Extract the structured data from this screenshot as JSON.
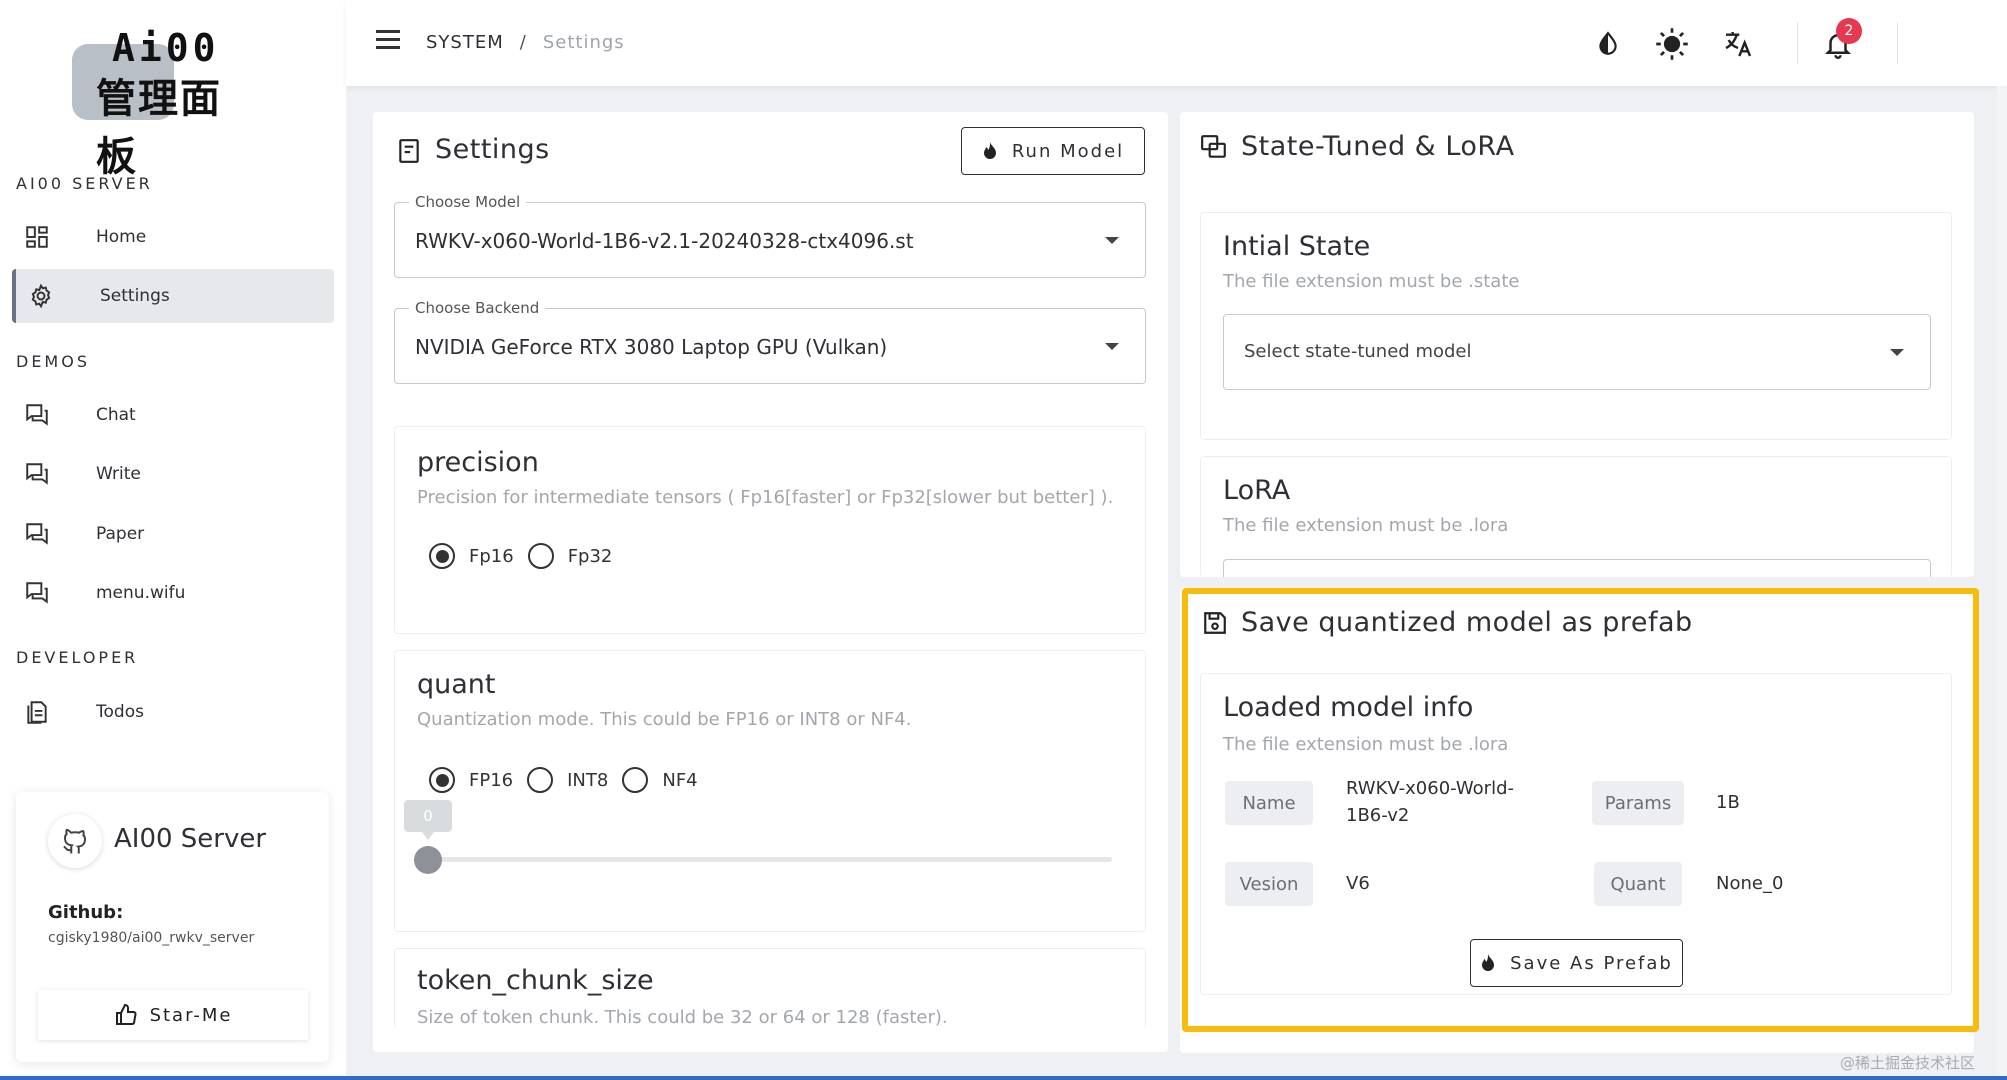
{
  "logo": {
    "line1": "Ai00",
    "line2": "管理面板"
  },
  "sidebar": {
    "sections": [
      {
        "title": "AI00 SERVER"
      },
      {
        "title": "DEMOS"
      },
      {
        "title": "DEVELOPER"
      }
    ],
    "items": [
      {
        "label": "Home",
        "icon": "dashboard-icon"
      },
      {
        "label": "Settings",
        "icon": "gear-icon",
        "active": true
      },
      {
        "label": "Chat",
        "icon": "forum-icon"
      },
      {
        "label": "Write",
        "icon": "forum-icon"
      },
      {
        "label": "Paper",
        "icon": "forum-icon"
      },
      {
        "label": "menu.wifu",
        "icon": "forum-icon"
      },
      {
        "label": "Todos",
        "icon": "document-icon"
      }
    ],
    "github_card": {
      "title": "AI00 Server",
      "github_label": "Github:",
      "url": "cgisky1980/ai00_rwkv_server",
      "star_label": "Star-Me"
    }
  },
  "header": {
    "breadcrumb": [
      "SYSTEM",
      "/",
      "Settings"
    ],
    "notification_count": "2",
    "icons": [
      "contrast-icon",
      "brightness-icon",
      "translate-icon",
      "bell-icon"
    ]
  },
  "settings": {
    "title": "Settings",
    "run_label": "Run Model",
    "model": {
      "legend": "Choose Model",
      "value": "RWKV-x060-World-1B6-v2.1-20240328-ctx4096.st"
    },
    "backend": {
      "legend": "Choose Backend",
      "value": "NVIDIA GeForce RTX 3080 Laptop GPU (Vulkan)"
    },
    "precision": {
      "title": "precision",
      "subtitle": "Precision for intermediate tensors ( Fp16[faster] or Fp32[slower but better] ).",
      "options": [
        "Fp16",
        "Fp32"
      ],
      "selected": "Fp16"
    },
    "quant": {
      "title": "quant",
      "subtitle": "Quantization mode. This could be FP16 or INT8 or NF4.",
      "options": [
        "FP16",
        "INT8",
        "NF4"
      ],
      "selected": "FP16",
      "slider_value": "0"
    },
    "token_chunk": {
      "title": "token_chunk_size",
      "subtitle": "Size of token chunk. This could be 32 or 64 or 128 (faster)."
    }
  },
  "state_lora": {
    "title": "State-Tuned & LoRA",
    "initial_state": {
      "title": "Intial State",
      "subtitle": "The file extension must be .state",
      "placeholder": "Select state-tuned model"
    },
    "lora": {
      "title": "LoRA",
      "subtitle": "The file extension must be .lora"
    }
  },
  "prefab": {
    "title": "Save quantized model as prefab",
    "info_title": "Loaded model info",
    "info_subtitle": "The file extension must be .lora",
    "fields": {
      "name_label": "Name",
      "name_value": "RWKV-x060-World-1B6-v2",
      "params_label": "Params",
      "params_value": "1B",
      "version_label": "Vesion",
      "version_value": "V6",
      "quant_label": "Quant",
      "quant_value": "None_0"
    },
    "save_label": "Save As Prefab"
  },
  "watermark": "@稀土掘金技术社区",
  "colors": {
    "highlight": "#f6bd0f",
    "badge": "#e53950",
    "accent": "#2d6fbf"
  }
}
